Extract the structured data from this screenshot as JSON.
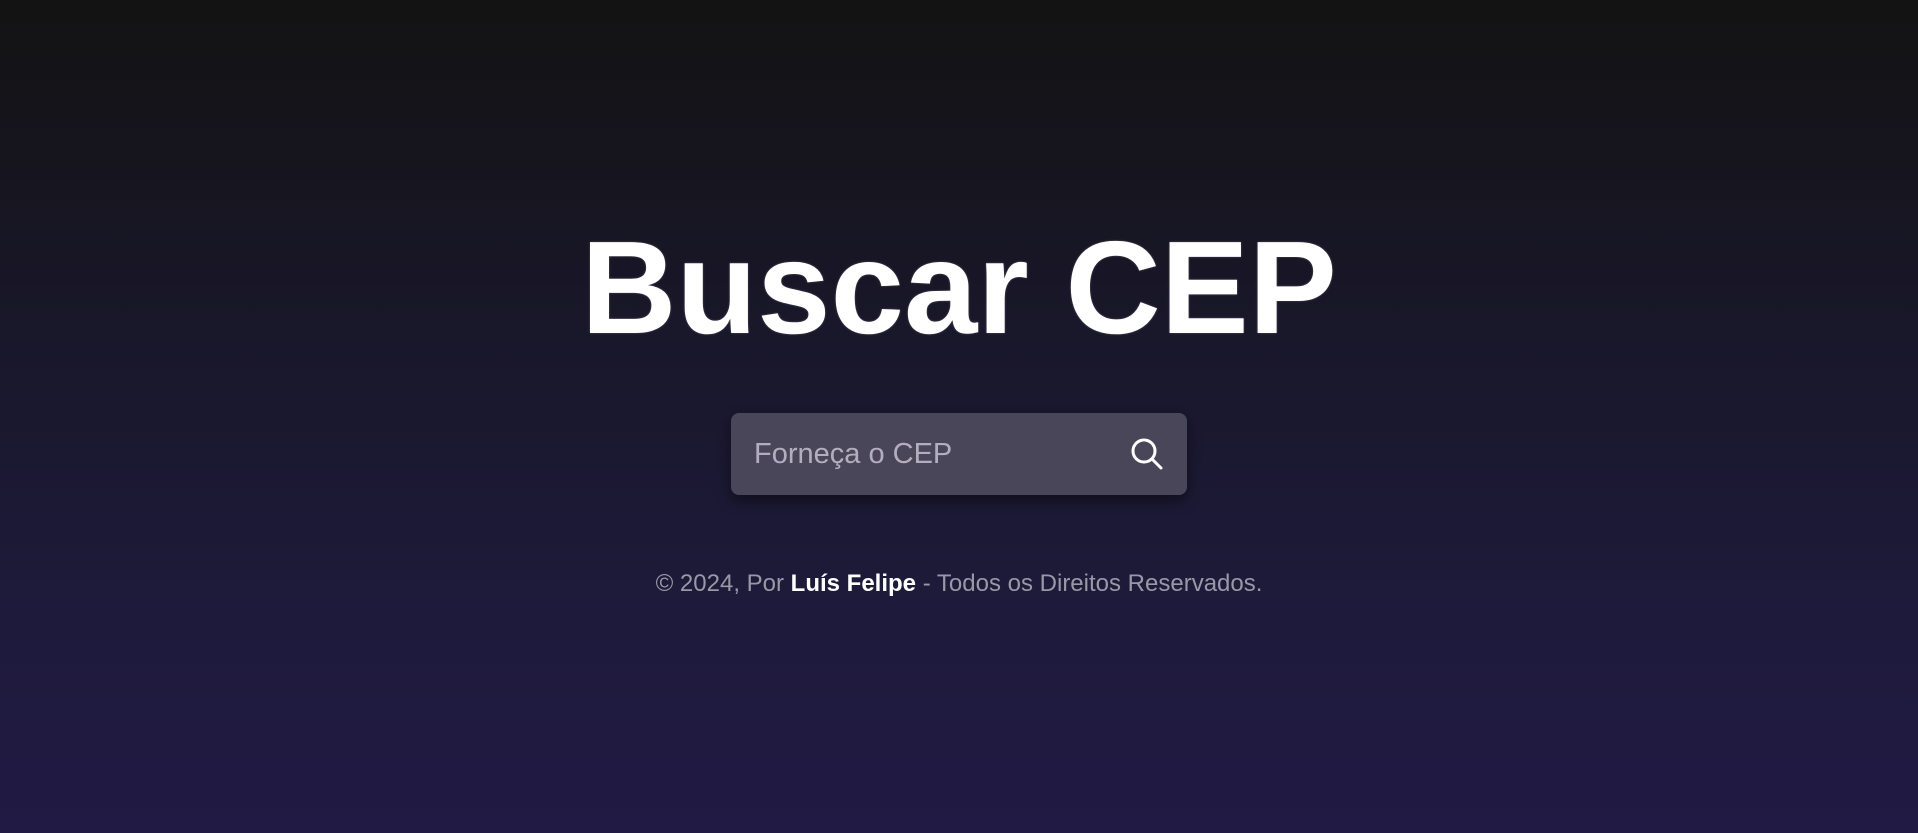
{
  "page": {
    "title": "Buscar CEP"
  },
  "search": {
    "placeholder": "Forneça o CEP",
    "value": "",
    "button_icon": "search-icon"
  },
  "footer": {
    "prefix": "© 2024, Por ",
    "author": "Luís Felipe",
    "suffix": " - Todos os Direitos Reservados."
  },
  "colors": {
    "background_top": "#131313",
    "background_bottom": "#211a44",
    "search_box": "#4a4659",
    "title": "#ffffff",
    "footer_text": "#9a97a6"
  }
}
